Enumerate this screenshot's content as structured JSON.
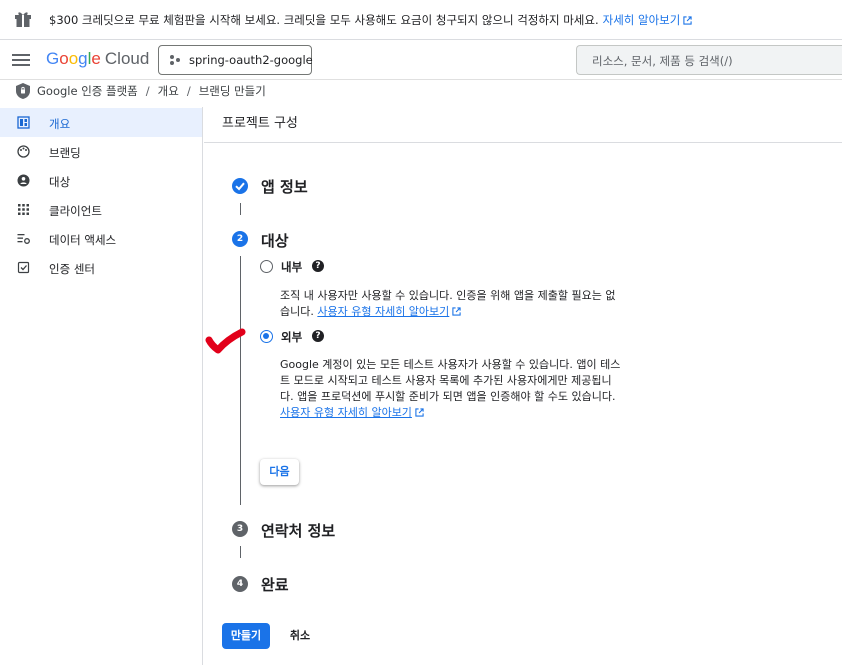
{
  "banner": {
    "text": "$300 크레딧으로 무료 체험판을 시작해 보세요. 크레딧을 모두 사용해도 요금이 청구되지 않으니 걱정하지 마세요.",
    "link": "자세히 알아보기"
  },
  "header": {
    "logo_google": [
      "G",
      "o",
      "o",
      "g",
      "l",
      "e"
    ],
    "logo_cloud": "Cloud",
    "project": "spring-oauth2-google",
    "search_placeholder": "리소스, 문서, 제품 등 검색(/)"
  },
  "breadcrumb": {
    "items": [
      "Google 인증 플랫폼",
      "개요",
      "브랜딩 만들기"
    ]
  },
  "sidebar": {
    "items": [
      {
        "label": "개요",
        "icon": "dashboard-icon",
        "active": true
      },
      {
        "label": "브랜딩",
        "icon": "palette-icon",
        "active": false
      },
      {
        "label": "대상",
        "icon": "person-icon",
        "active": false
      },
      {
        "label": "클라이언트",
        "icon": "grid-icon",
        "active": false
      },
      {
        "label": "데이터 액세스",
        "icon": "settings-list-icon",
        "active": false
      },
      {
        "label": "인증 센터",
        "icon": "verified-icon",
        "active": false
      }
    ]
  },
  "main": {
    "title": "프로젝트 구성",
    "steps": [
      {
        "num": "1",
        "title": "앱 정보",
        "state": "done"
      },
      {
        "num": "2",
        "title": "대상",
        "state": "active"
      },
      {
        "num": "3",
        "title": "연락처 정보",
        "state": "pending"
      },
      {
        "num": "4",
        "title": "완료",
        "state": "pending"
      }
    ],
    "audience": {
      "internal": {
        "label": "내부",
        "desc_line1": "조직 내 사용자만 사용할 수 있습니다. 인증을 위해 앱을 제출할 필요는 없",
        "desc_line2": "습니다.",
        "link": "사용자 유형 자세히 알아보기",
        "selected": false
      },
      "external": {
        "label": "외부",
        "desc_line1": "Google 계정이 있는 모든 테스트 사용자가 사용할 수 있습니다. 앱이 테스",
        "desc_line2": "트 모드로 시작되고 테스트 사용자 목록에 추가된 사용자에게만 제공됩니",
        "desc_line3": "다. 앱을 프로덕션에 푸시할 준비가 되면 앱을 인증해야 할 수도 있습니다.",
        "link": "사용자 유형 자세히 알아보기",
        "selected": true
      },
      "help_glyph": "?"
    },
    "next_button": "다음",
    "create_button": "만들기",
    "cancel_button": "취소"
  },
  "colors": {
    "accent": "#1a73e8",
    "annotation": "#e2001a"
  }
}
